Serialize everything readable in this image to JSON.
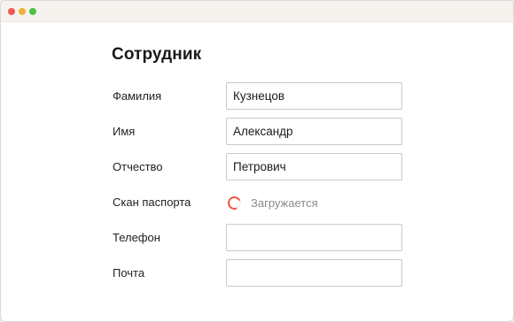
{
  "window": {
    "controls": [
      "close",
      "minimize",
      "maximize"
    ]
  },
  "form": {
    "title": "Сотрудник",
    "fields": {
      "last_name": {
        "label": "Фамилия",
        "value": "Кузнецов"
      },
      "first_name": {
        "label": "Имя",
        "value": "Александр"
      },
      "middle_name": {
        "label": "Отчество",
        "value": "Петрович"
      },
      "passport_scan": {
        "label": "Скан паспорта",
        "status": "Загружается"
      },
      "phone": {
        "label": "Телефон",
        "value": ""
      },
      "email": {
        "label": "Почта",
        "value": ""
      }
    }
  },
  "colors": {
    "spinner": "#f05545",
    "status_text": "#8b8b8b",
    "titlebar": "#f6f3ef"
  }
}
